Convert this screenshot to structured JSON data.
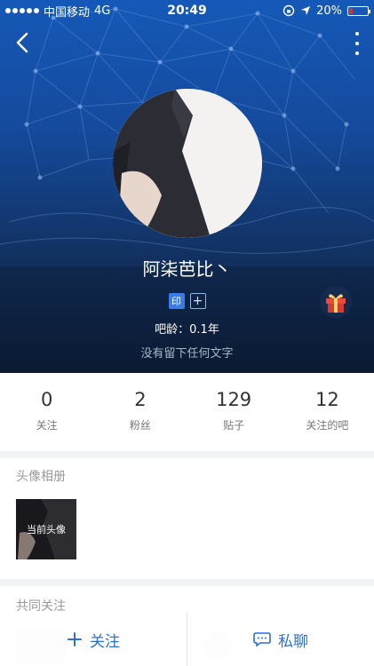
{
  "status_bar": {
    "carrier": "中国移动",
    "network": "4G",
    "time": "20:49",
    "battery": "20%",
    "battery_level": 0.2,
    "battery_color": "#e0302c"
  },
  "nav": {
    "back_icon": "chevron-left-icon",
    "more_icon": "vertical-dots-icon"
  },
  "profile": {
    "nickname": "阿柒芭比丶",
    "badges": [
      "印",
      "+"
    ],
    "bar_age": "吧龄：0.1年",
    "signature": "没有留下任何文字",
    "gift_icon": "gift-icon"
  },
  "stats": [
    {
      "value": "0",
      "label": "关注"
    },
    {
      "value": "2",
      "label": "粉丝"
    },
    {
      "value": "129",
      "label": "贴子"
    },
    {
      "value": "12",
      "label": "关注的吧"
    }
  ],
  "album": {
    "title": "头像相册",
    "current_label": "当前头像"
  },
  "common": {
    "title": "共同关注"
  },
  "actions": {
    "follow_label": "关注",
    "follow_icon": "plus-icon",
    "message_label": "私聊",
    "message_icon": "chat-bubble-icon"
  },
  "colors": {
    "accent": "#2a6fdb",
    "hero_top": "#1559b8",
    "hero_bottom": "#0c1b33"
  }
}
